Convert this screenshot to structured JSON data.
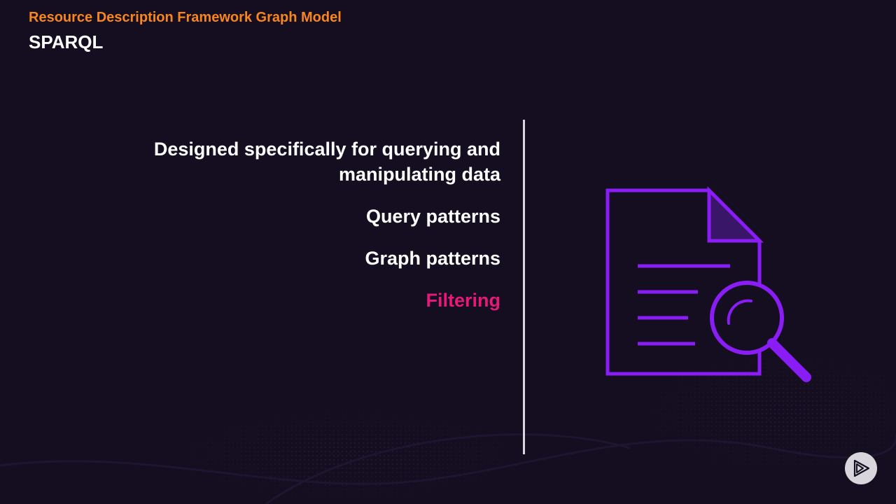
{
  "header": {
    "section_title": "Resource Description Framework Graph Model",
    "slide_title": "SPARQL"
  },
  "bullets": [
    {
      "line1": "Designed specifically for querying and",
      "line2": "manipulating data"
    },
    {
      "text": "Query patterns"
    },
    {
      "text": "Graph patterns"
    },
    {
      "text": "Filtering"
    }
  ],
  "colors": {
    "accent_orange": "#f7861e",
    "highlight_pink": "#e5197a",
    "icon_purple": "#8a1cf5",
    "background": "#140e20"
  },
  "icons": {
    "illustration": "document-search-icon",
    "logo": "pluralsight-play-icon"
  }
}
